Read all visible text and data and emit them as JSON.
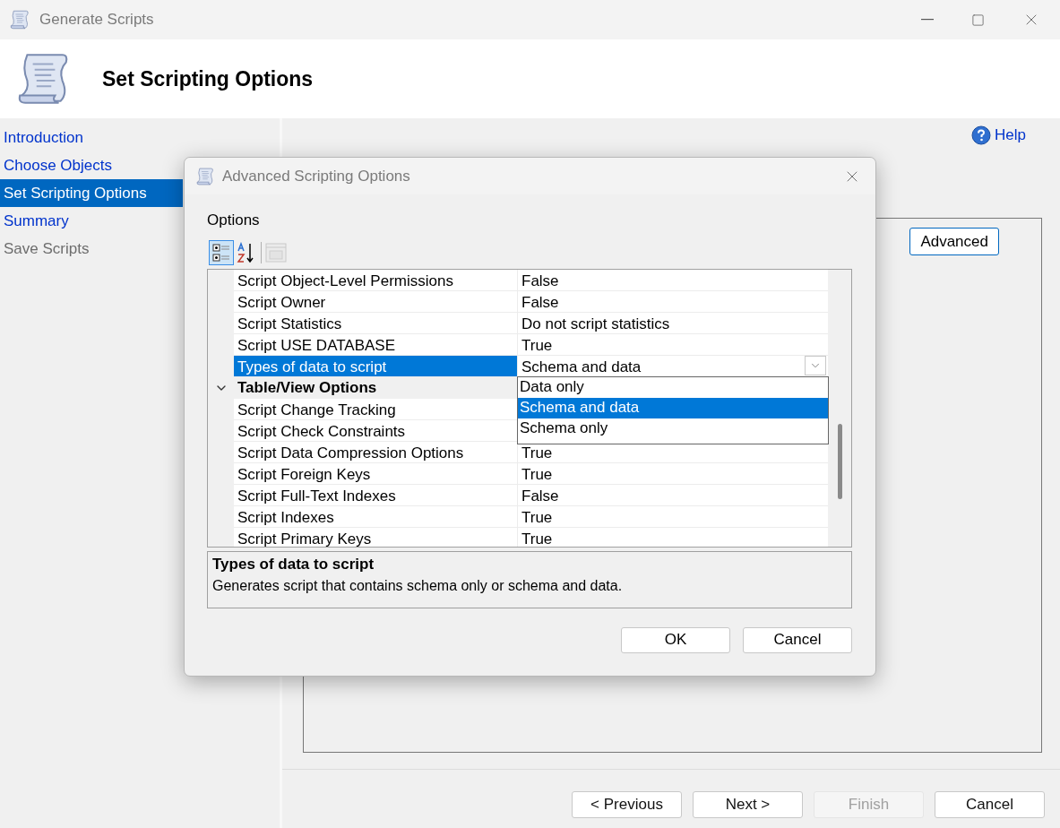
{
  "window": {
    "title": "Generate Scripts"
  },
  "header": {
    "title": "Set Scripting Options"
  },
  "nav": [
    {
      "label": "Introduction",
      "selected": false,
      "disabled": false
    },
    {
      "label": "Choose Objects",
      "selected": false,
      "disabled": false
    },
    {
      "label": "Set Scripting Options",
      "selected": true,
      "disabled": false
    },
    {
      "label": "Summary",
      "selected": false,
      "disabled": false
    },
    {
      "label": "Save Scripts",
      "selected": false,
      "disabled": true
    }
  ],
  "help_link": "Help",
  "advanced_button": "Advanced",
  "footer_buttons": [
    {
      "label": "< Previous",
      "disabled": false
    },
    {
      "label": "Next >",
      "disabled": false
    },
    {
      "label": "Finish",
      "disabled": true
    },
    {
      "label": "Cancel",
      "disabled": false
    }
  ],
  "dialog": {
    "title": "Advanced Scripting Options",
    "section_label": "Options",
    "toolbar": [
      {
        "kind": "categorized",
        "selected": true,
        "disabled": false
      },
      {
        "kind": "alphabetical",
        "selected": false,
        "disabled": false
      },
      {
        "kind": "pages",
        "selected": false,
        "disabled": true
      }
    ],
    "rows": [
      {
        "kind": "property",
        "name": "Script Object-Level Permissions",
        "value": "False",
        "selected": false
      },
      {
        "kind": "property",
        "name": "Script Owner",
        "value": "False",
        "selected": false
      },
      {
        "kind": "property",
        "name": "Script Statistics",
        "value": "Do not script statistics",
        "selected": false
      },
      {
        "kind": "property",
        "name": "Script USE DATABASE",
        "value": "True",
        "selected": false
      },
      {
        "kind": "property",
        "name": "Types of data to script",
        "value": "Schema and data",
        "selected": true
      },
      {
        "kind": "category",
        "name": "Table/View Options",
        "expanded": true
      },
      {
        "kind": "property",
        "name": "Script Change Tracking",
        "selected": false
      },
      {
        "kind": "property",
        "name": "Script Check Constraints",
        "selected": false
      },
      {
        "kind": "property",
        "name": "Script Data Compression Options",
        "value": "True",
        "selected": false
      },
      {
        "kind": "property",
        "name": "Script Foreign Keys",
        "value": "True",
        "selected": false
      },
      {
        "kind": "property",
        "name": "Script Full-Text Indexes",
        "value": "False",
        "selected": false
      },
      {
        "kind": "property",
        "name": "Script Indexes",
        "value": "True",
        "selected": false
      },
      {
        "kind": "property",
        "name": "Script Primary Keys",
        "value": "True",
        "selected": false
      }
    ],
    "dropdown": [
      {
        "label": "Data only",
        "selected": false
      },
      {
        "label": "Schema and data",
        "selected": true
      },
      {
        "label": "Schema only",
        "selected": false
      }
    ],
    "description": {
      "title": "Types of data to script",
      "text": "Generates script that contains schema only or schema and data."
    },
    "buttons": [
      "OK",
      "Cancel"
    ]
  }
}
